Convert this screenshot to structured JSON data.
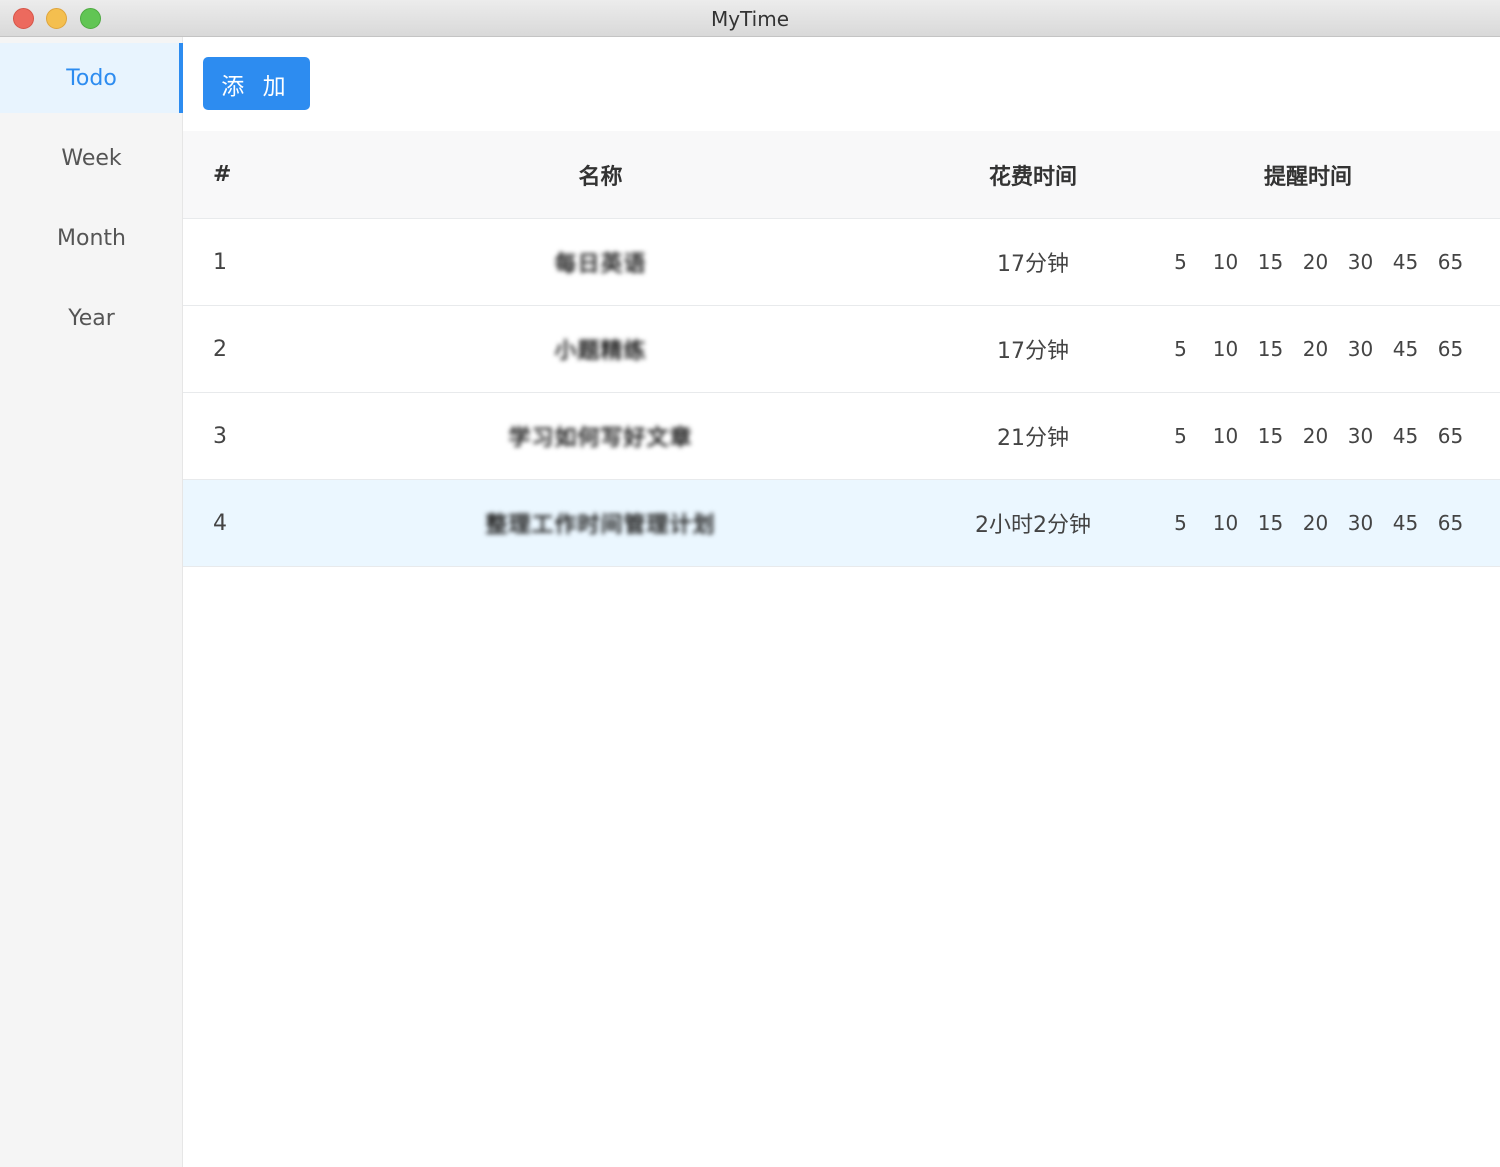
{
  "window": {
    "title": "MyTime"
  },
  "sidebar": {
    "items": [
      {
        "label": "Todo",
        "active": true
      },
      {
        "label": "Week",
        "active": false
      },
      {
        "label": "Month",
        "active": false
      },
      {
        "label": "Year",
        "active": false
      }
    ]
  },
  "toolbar": {
    "add_label": "添 加"
  },
  "table": {
    "headers": {
      "index": "#",
      "name": "名称",
      "cost": "花费时间",
      "remind": "提醒时间"
    },
    "rows": [
      {
        "index": "1",
        "name": "每日英语",
        "cost": "17分钟",
        "reminders": [
          "5",
          "10",
          "15",
          "20",
          "30",
          "45",
          "65"
        ]
      },
      {
        "index": "2",
        "name": "小题精练",
        "cost": "17分钟",
        "reminders": [
          "5",
          "10",
          "15",
          "20",
          "30",
          "45",
          "65"
        ]
      },
      {
        "index": "3",
        "name": "学习如何写好文章",
        "cost": "21分钟",
        "reminders": [
          "5",
          "10",
          "15",
          "20",
          "30",
          "45",
          "65"
        ]
      },
      {
        "index": "4",
        "name": "整理工作时间管理计划",
        "cost": "2小时2分钟",
        "reminders": [
          "5",
          "10",
          "15",
          "20",
          "30",
          "45",
          "65"
        ]
      }
    ],
    "highlighted_row": 4
  },
  "colors": {
    "accent": "#2d8cf0",
    "highlight_row": "#ebf7ff",
    "sidebar_bg": "#f5f5f5"
  }
}
